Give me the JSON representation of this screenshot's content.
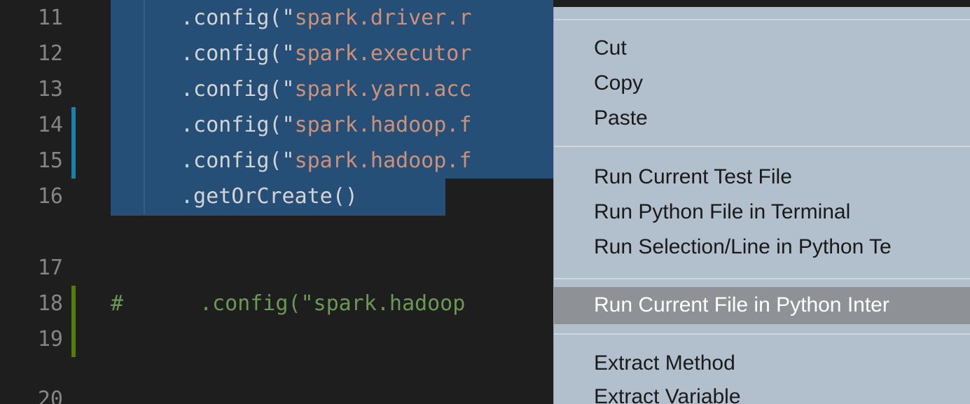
{
  "editor": {
    "lines": [
      {
        "num": "11",
        "pre": ".config(\"",
        "str": "spark.driver.r",
        "selected": true,
        "mark": "none"
      },
      {
        "num": "12",
        "pre": ".config(\"",
        "str": "spark.executor",
        "selected": true,
        "mark": "none"
      },
      {
        "num": "13",
        "pre": ".config(\"",
        "str": "spark.yarn.acc",
        "selected": true,
        "mark": "none"
      },
      {
        "num": "14",
        "pre": ".config(\"",
        "str": "spark.hadoop.f",
        "selected": true,
        "mark": "modified"
      },
      {
        "num": "15",
        "pre": ".config(\"",
        "str": "spark.hadoop.f",
        "selected": true,
        "mark": "modified"
      },
      {
        "num": "16",
        "pre": ".getOrCreate()",
        "str": "",
        "selected": true,
        "mark": "none"
      },
      {
        "num": "17",
        "pre": "",
        "str": "",
        "selected": false,
        "mark": "none"
      },
      {
        "num": "18",
        "hash": "#",
        "comment": ".config(\"spark.hadoop",
        "selected": false,
        "mark": "added"
      },
      {
        "num": "19",
        "pre": "",
        "str": "",
        "selected": false,
        "mark": "added"
      },
      {
        "num": "20",
        "pre": "",
        "str": "",
        "selected": false,
        "mark": "none"
      }
    ]
  },
  "context_menu": {
    "items": [
      "Cut",
      "Copy",
      "Paste",
      "Run Current Test File",
      "Run Python File in Terminal",
      "Run Selection/Line in Python Te",
      "Run Current File in Python Inter",
      "Extract Method",
      "Extract Variable"
    ],
    "active_item": "Run Current File in Python Inter"
  },
  "colors": {
    "selection": "#264f78",
    "modified_mark": "#1b81a8",
    "added_mark": "#587c0c",
    "string": "#ce9178",
    "comment": "#6a9955",
    "menu_bg": "#b2bfcc",
    "menu_highlight": "#8e9297"
  }
}
